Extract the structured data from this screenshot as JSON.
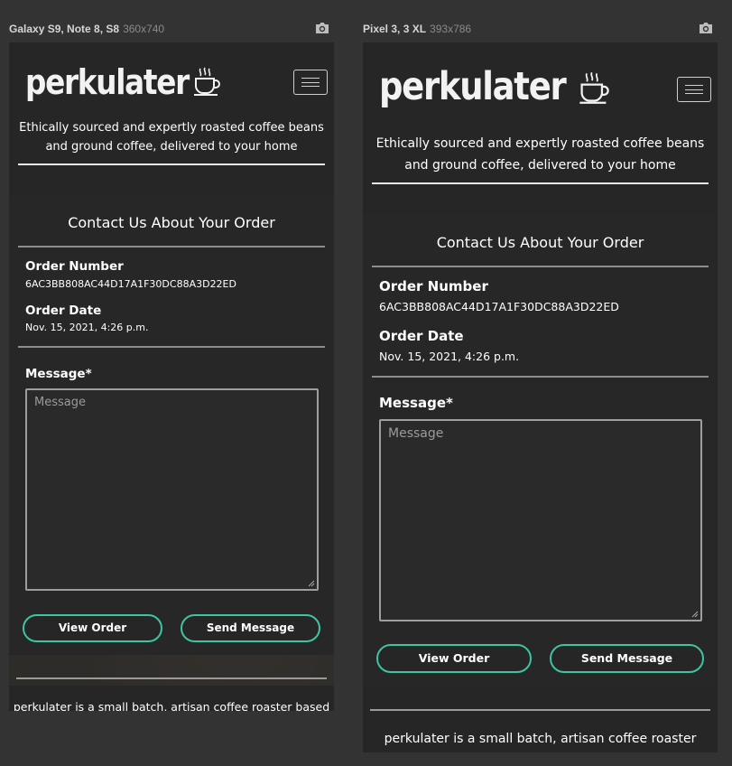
{
  "devices": [
    {
      "name": "Galaxy S9, Note 8, S8",
      "size": "360x740"
    },
    {
      "name": "Pixel 3, 3 XL",
      "size": "393x786"
    }
  ],
  "icons": {
    "camera": "camera-icon",
    "menu": "hamburger-menu-icon",
    "cup": "coffee-cup-icon"
  },
  "site": {
    "logo": "perkulater",
    "tagline": "Ethically sourced and expertly roasted coffee beans and ground coffee, delivered to your home"
  },
  "contact": {
    "title": "Contact Us About Your Order",
    "order_number_label": "Order Number",
    "order_number": "6AC3BB808AC44D17A1F30DC88A3D22ED",
    "order_date_label": "Order Date",
    "order_date": "Nov. 15, 2021, 4:26 p.m.",
    "message_label": "Message*",
    "message_placeholder": "Message",
    "view_order": "View Order",
    "send_message": "Send Message"
  },
  "footer": {
    "text_a": "perkulater is a small batch, artisan coffee roaster based",
    "text_b": "perkulater is a small batch, artisan coffee roaster"
  },
  "colors": {
    "accent": "#3ec4a0",
    "background": "#333333",
    "panel": "#262626"
  }
}
